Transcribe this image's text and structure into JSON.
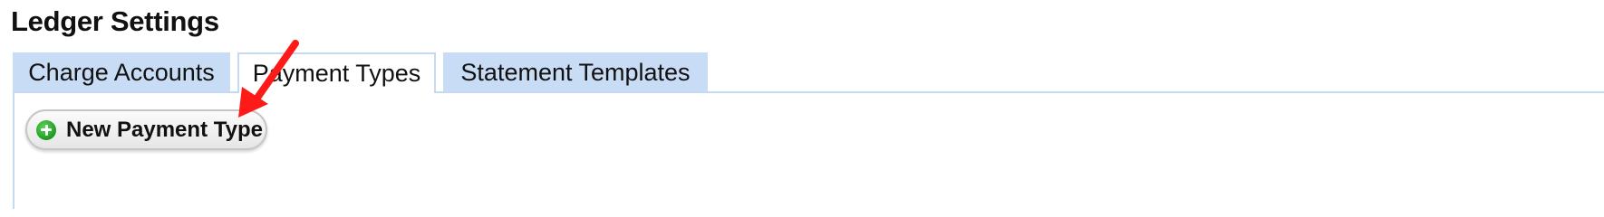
{
  "page": {
    "title": "Ledger Settings"
  },
  "tabs": [
    {
      "label": "Charge Accounts",
      "active": false
    },
    {
      "label": "Payment Types",
      "active": true
    },
    {
      "label": "Statement Templates",
      "active": false
    }
  ],
  "toolbar": {
    "new_button_label": "New Payment Type",
    "new_button_icon": "plus-circle-icon"
  },
  "annotation": {
    "arrow_color": "#ff1a1a",
    "icon": "arrow-icon"
  },
  "colors": {
    "tab_background": "#c8dcf5",
    "panel_border": "#c5d9f1",
    "add_icon_green": "#1f9a1f"
  }
}
